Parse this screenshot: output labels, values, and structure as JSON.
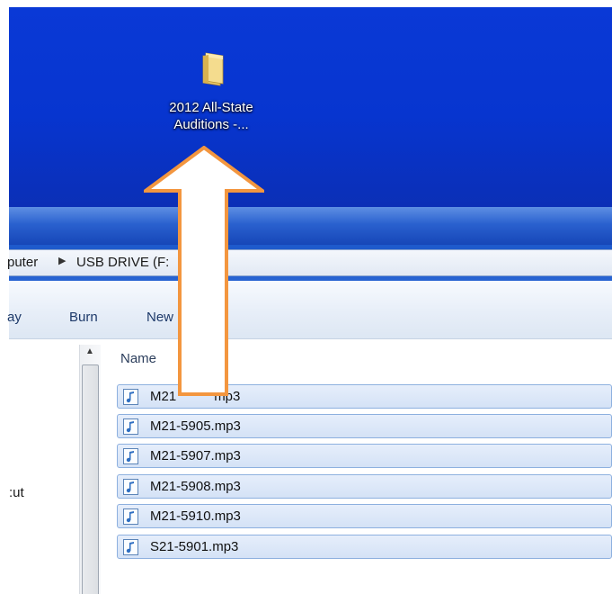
{
  "desktop": {
    "folder": {
      "label_line1": "2012 All-State",
      "label_line2": "Auditions -...",
      "icon": "folder-icon"
    },
    "background_color": "#0a39d6"
  },
  "address_bar": {
    "crumb_partial": "puter",
    "crumb_current": "USB DRIVE (F:"
  },
  "toolbar": {
    "item_partial": "ay",
    "burn": "Burn",
    "new_partial": "New"
  },
  "nav_pane": {
    "item_partial": ":ut"
  },
  "file_list": {
    "column_header": "Name",
    "files": [
      {
        "name": "M21",
        "suffix": "mp3",
        "icon": "music-file-icon"
      },
      {
        "name": "M21-5905.mp3",
        "icon": "music-file-icon"
      },
      {
        "name": "M21-5907.mp3",
        "icon": "music-file-icon"
      },
      {
        "name": "M21-5908.mp3",
        "icon": "music-file-icon"
      },
      {
        "name": "M21-5910.mp3",
        "icon": "music-file-icon"
      },
      {
        "name": "S21-5901.mp3",
        "icon": "music-file-icon"
      }
    ]
  },
  "overlay": {
    "arrow_direction": "up",
    "arrow_color": "#f3963f",
    "arrow_fill": "#ffffff"
  }
}
